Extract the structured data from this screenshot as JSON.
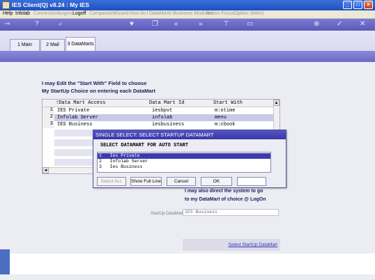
{
  "window": {
    "title": "IES Client(Q) v8.24 : My IES"
  },
  "menu": [
    {
      "label": "Help",
      "dim": false
    },
    {
      "label": "Infolab",
      "dim": false
    },
    {
      "label": "Connections",
      "dim": true
    },
    {
      "label": "Logon",
      "dim": true
    },
    {
      "label": "Logoff",
      "dim": false
    },
    {
      "label": "Companion",
      "dim": true
    },
    {
      "label": "Wizard",
      "dim": true
    },
    {
      "label": "How do I",
      "dim": true
    },
    {
      "label": "DataMarts",
      "dim": true
    },
    {
      "label": "Business Modules",
      "dim": true
    },
    {
      "label": "Action Focus",
      "dim": true
    },
    {
      "label": "Option Select",
      "dim": true
    }
  ],
  "tabs": [
    {
      "label": "1 Main"
    },
    {
      "label": "2 Mail"
    },
    {
      "label": "3 DataMarts"
    }
  ],
  "heading": {
    "line1": "I may Edit the \"Start With\" Field to choose",
    "line2": "My StartUp Choice on entering each DataMart"
  },
  "grid": {
    "columns": [
      "!Data Mart Access",
      "Data Mart Id",
      "Start With"
    ],
    "rows": [
      {
        "num": "1",
        "name": "IES Private",
        "id": "iesbpvt",
        "start": "m:otime"
      },
      {
        "num": "2",
        "name": "Infolab Server",
        "id": "infolab",
        "start": "menu"
      },
      {
        "num": "3",
        "name": "IES Business",
        "id": "iesbusiness",
        "start": "m:cbook"
      }
    ]
  },
  "dialog": {
    "title": "SINGLE SELECT: SELECT STARTUP DATAMART",
    "header": "SELECT DATAMART FOR AUTO START",
    "items": [
      "1   Ies Private",
      "2   Infolab Server",
      "3   Ies Business"
    ],
    "buttons": {
      "select_all": "Select ALL",
      "show_full_line": "Show Full Line",
      "cancel": "Cancel",
      "ok": "OK"
    }
  },
  "note": {
    "line1": "I may also direct the system to go",
    "line2": "to my DataMart of choice @ LogOn"
  },
  "startup": {
    "label": "StartUp DataMart",
    "value": "IES Business",
    "link": "Select StartUp DataMart"
  },
  "colors": {
    "toolbar": "#5a5abb",
    "titlebar": "#1e50c0",
    "selection": "#3c3cb0"
  }
}
